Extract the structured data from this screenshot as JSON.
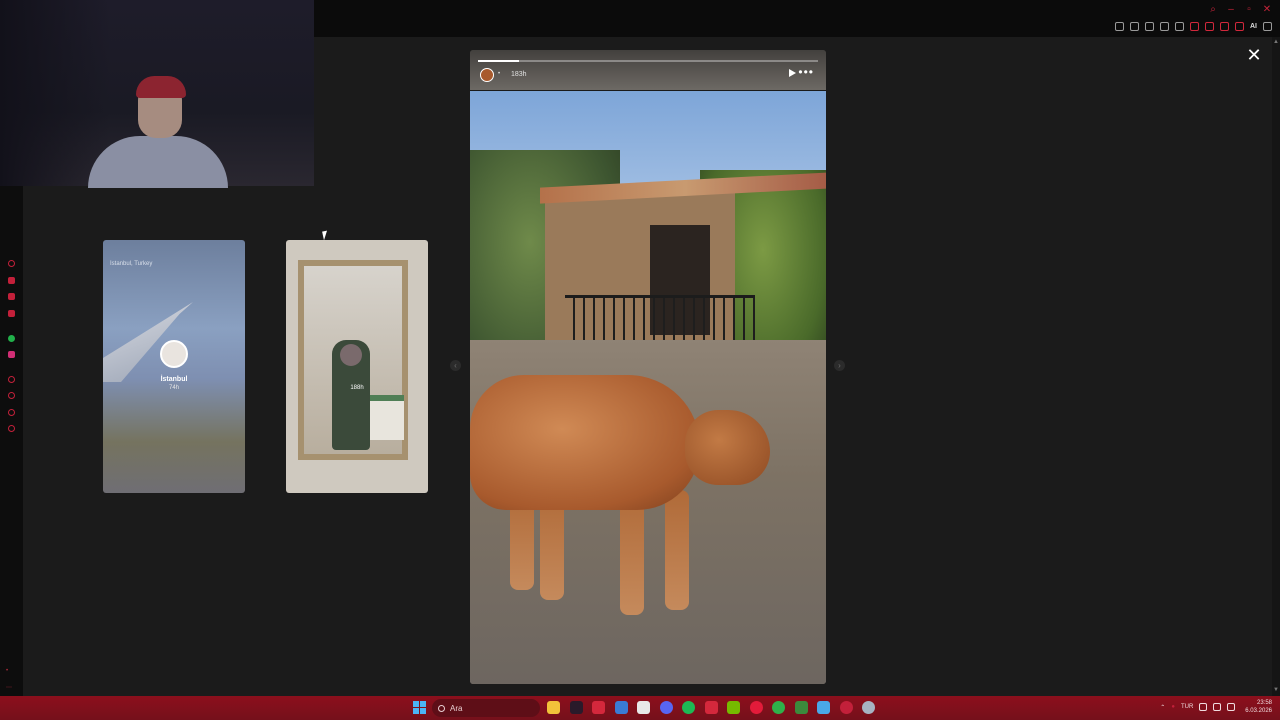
{
  "colors": {
    "accent": "#c3203a",
    "taskbar": "#8c0f1c",
    "background": "#1b1b1b"
  },
  "browser": {
    "toolbar_ai_label": "AI"
  },
  "stories": {
    "thumbnails": [
      {
        "location": "İstanbul, Turkey",
        "name": "İstanbul",
        "age": "74h"
      },
      {
        "age": "188h"
      }
    ],
    "current": {
      "age": "183h",
      "more_label": "•••",
      "progress": 0.12
    },
    "close_label": "✕",
    "prev_arrow": "‹",
    "next_arrow": "›"
  },
  "taskbar": {
    "search_placeholder": "Ara",
    "language": "TUR",
    "time": "23:58",
    "date": "6.03.2026",
    "app_icons": [
      "file-explorer-icon",
      "app-dark-icon",
      "security-icon",
      "mail-icon",
      "store-icon",
      "discord-icon",
      "spotify-icon",
      "letter-l-icon",
      "nvidia-icon",
      "opera-icon",
      "xbox-icon",
      "minecraft-icon",
      "app-blue-icon",
      "chrome-icon",
      "settings-icon"
    ]
  }
}
